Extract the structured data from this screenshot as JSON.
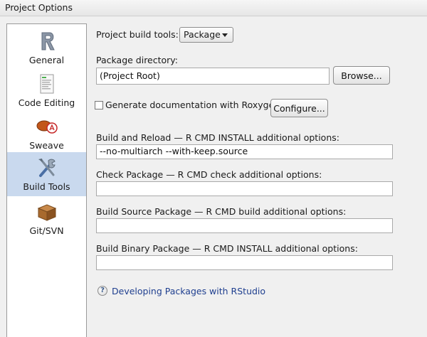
{
  "window": {
    "title": "Project Options"
  },
  "sidebar": {
    "items": [
      {
        "label": "General",
        "icon": "r-logo-icon"
      },
      {
        "label": "Code Editing",
        "icon": "code-editing-icon"
      },
      {
        "label": "Sweave",
        "icon": "sweave-icon"
      },
      {
        "label": "Build Tools",
        "icon": "build-tools-icon",
        "active": true
      },
      {
        "label": "Git/SVN",
        "icon": "git-box-icon"
      }
    ]
  },
  "build": {
    "project_build_tools_label": "Project build tools:",
    "project_build_tools_value": "Package",
    "package_directory_label": "Package directory:",
    "package_directory_value": "(Project Root)",
    "browse_label": "Browse...",
    "roxygen_label": "Generate documentation with Roxygen",
    "roxygen_checked": false,
    "configure_label": "Configure...",
    "build_reload_label": "Build and Reload — R CMD INSTALL additional options:",
    "build_reload_value": "--no-multiarch --with-keep.source",
    "check_label": "Check Package — R CMD check additional options:",
    "check_value": "",
    "build_source_label": "Build Source Package — R CMD build additional options:",
    "build_source_value": "",
    "build_binary_label": "Build Binary Package — R CMD INSTALL additional options:",
    "build_binary_value": "",
    "help_link": "Developing Packages with RStudio"
  },
  "colors": {
    "active_item": "#c9d9ee",
    "link": "#1f3f8f"
  }
}
